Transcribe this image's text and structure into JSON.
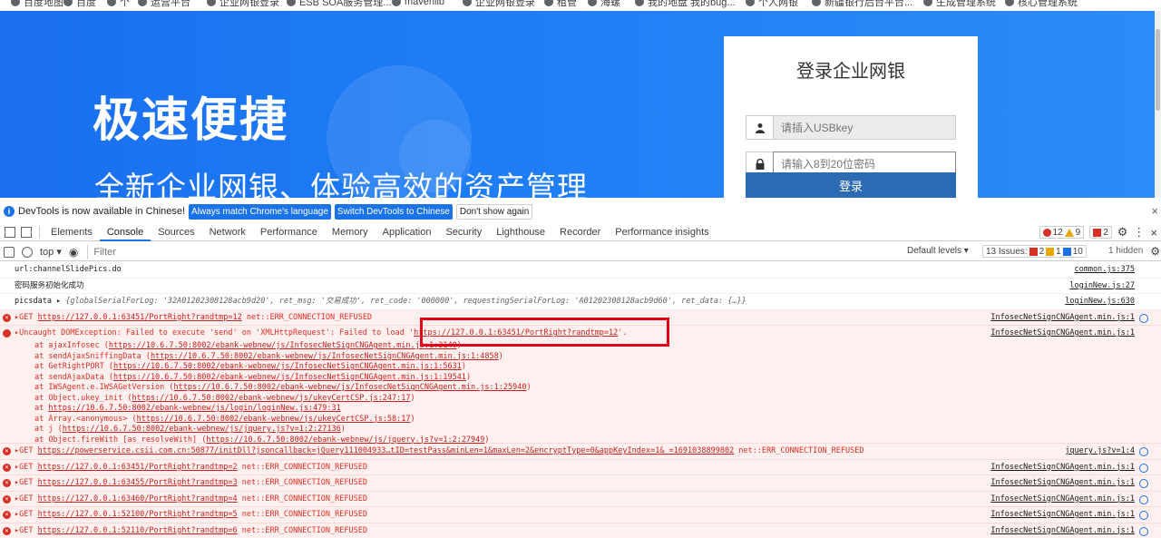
{
  "bookmarks": [
    "百度地图",
    "百度",
    "个",
    "运营平台",
    "企业网银登录",
    "ESB SOA服务管理...",
    "mavenlib",
    "企业网银登录",
    "租管",
    "海螺",
    "我的地盘 我的bug...",
    "个人网银",
    "新疆银行后台平台...",
    "生成管理系统",
    "核心管理系统"
  ],
  "banner": {
    "headline": "极速便捷",
    "subline": "全新企业网银、体验高效的资产管理"
  },
  "login": {
    "title": "登录企业网银",
    "usb_placeholder": "请插入USBkey",
    "pwd_placeholder": "请输入8到20位密码",
    "button": "登录"
  },
  "infobar": {
    "text": "DevTools is now available in Chinese!",
    "btn_match": "Always match Chrome's language",
    "btn_switch": "Switch DevTools to Chinese",
    "btn_dismiss": "Don't show again",
    "close": "×"
  },
  "tabs": [
    "Elements",
    "Console",
    "Sources",
    "Network",
    "Performance",
    "Memory",
    "Application",
    "Security",
    "Lighthouse",
    "Recorder",
    "Performance insights"
  ],
  "counts": {
    "errors": "12",
    "warnings": "9",
    "issues_badge": "2"
  },
  "toolbar": {
    "context": "top ▾",
    "filter_placeholder": "Filter",
    "levels": "Default levels ▾",
    "issues_label": "13 Issues:",
    "issues_err": "2",
    "issues_warn": "1",
    "issues_info": "10",
    "hidden": "1 hidden"
  },
  "console": {
    "m1": {
      "text": "url:channelSlidePics.do",
      "src": "common.js:375"
    },
    "m2": {
      "text": "密码服务初始化成功",
      "src": "loginNew.js:27"
    },
    "m3": {
      "label": "picsdata ▸",
      "obj": "{globalSerialForLog: '32A01202308128acb9d20', ret_msg: '交易成功', ret_code: '000000', requestingSerialForLog: 'A01202308128acb9d60', ret_data: {…}}",
      "src": "loginNew.js:630"
    },
    "e1": {
      "pre": "▸GET ",
      "url": "https://127.0.0.1:63451/PortRight?randtmp=12",
      "post": " net::ERR_CONNECTION_REFUSED",
      "src": "InfosecNetSignCNGAgent.min.js:1"
    },
    "exception": {
      "pre": "▸Uncaught DOMException: Failed to execute 'send' on 'XMLHttpRequest': Failed to load '",
      "url": "https://127.0.0.1:63451/PortRight?randtmp=12",
      "post": "'.",
      "src": "InfosecNetSignCNGAgent.min.js:1",
      "frames": [
        {
          "at": "at ajaxInfosec (",
          "url": "https://10.6.7.50:8002/ebank-webnew/js/InfosecNetSignCNGAgent.min.js:1:3140",
          "end": ")"
        },
        {
          "at": "at sendAjaxSniffingData (",
          "url": "https://10.6.7.50:8002/ebank-webnew/js/InfosecNetSignCNGAgent.min.js:1:4858",
          "end": ")"
        },
        {
          "at": "at GetRightPORT (",
          "url": "https://10.6.7.50:8002/ebank-webnew/js/InfosecNetSignCNGAgent.min.js:1:5631",
          "end": ")"
        },
        {
          "at": "at sendAjaxData (",
          "url": "https://10.6.7.50:8002/ebank-webnew/js/InfosecNetSignCNGAgent.min.js:1:19541",
          "end": ")"
        },
        {
          "at": "at IWSAgent.e.IWSAGetVersion (",
          "url": "https://10.6.7.50:8002/ebank-webnew/js/InfosecNetSignCNGAgent.min.js:1:25940",
          "end": ")"
        },
        {
          "at": "at Object.ukey_init (",
          "url": "https://10.6.7.50:8002/ebank-webnew/js/ukeyCertCSP.js:247:17",
          "end": ")"
        },
        {
          "at": "at ",
          "url": "https://10.6.7.50:8002/ebank-webnew/js/login/loginNew.js:479:31",
          "end": ""
        },
        {
          "at": "at Array.<anonymous> (",
          "url": "https://10.6.7.50:8002/ebank-webnew/js/ukeyCertCSP.js:58:17",
          "end": ")"
        },
        {
          "at": "at j (",
          "url": "https://10.6.7.50:8002/ebank-webnew/js/jquery.js?v=1:2:27136",
          "end": ")"
        },
        {
          "at": "at Object.fireWith [as resolveWith] (",
          "url": "https://10.6.7.50:8002/ebank-webnew/js/jquery.js?v=1:2:27949",
          "end": ")"
        }
      ]
    },
    "e2": {
      "pre": "▸GET ",
      "url": "https://powerservice.csii.com.cn:50877/initDll?jsoncallback=jQuery111004933…tID=testPass&minLen=1&maxLen=2&encryptType=0&appKeyIndex=1&_=1691038899802",
      "post": " net::ERR_CONNECTION_REFUSED",
      "src": "jquery.js?v=1:4"
    },
    "e3": {
      "pre": "▸GET ",
      "url": "https://127.0.0.1:63451/PortRight?randtmp=2",
      "post": " net::ERR_CONNECTION_REFUSED",
      "src": "InfosecNetSignCNGAgent.min.js:1"
    },
    "e4": {
      "pre": "▸GET ",
      "url": "https://127.0.0.1:63455/PortRight?randtmp=3",
      "post": " net::ERR_CONNECTION_REFUSED",
      "src": "InfosecNetSignCNGAgent.min.js:1"
    },
    "e5": {
      "pre": "▸GET ",
      "url": "https://127.0.0.1:63460/PortRight?randtmp=4",
      "post": " net::ERR_CONNECTION_REFUSED",
      "src": "InfosecNetSignCNGAgent.min.js:1"
    },
    "e6": {
      "pre": "▸GET ",
      "url": "https://127.0.0.1:52100/PortRight?randtmp=5",
      "post": " net::ERR_CONNECTION_REFUSED",
      "src": "InfosecNetSignCNGAgent.min.js:1"
    },
    "e7": {
      "pre": "▸GET ",
      "url": "https://127.0.0.1:52110/PortRight?randtmp=6",
      "post": " net::ERR_CONNECTION_REFUSED",
      "src": "InfosecNetSignCNGAgent.min.js:1"
    }
  }
}
